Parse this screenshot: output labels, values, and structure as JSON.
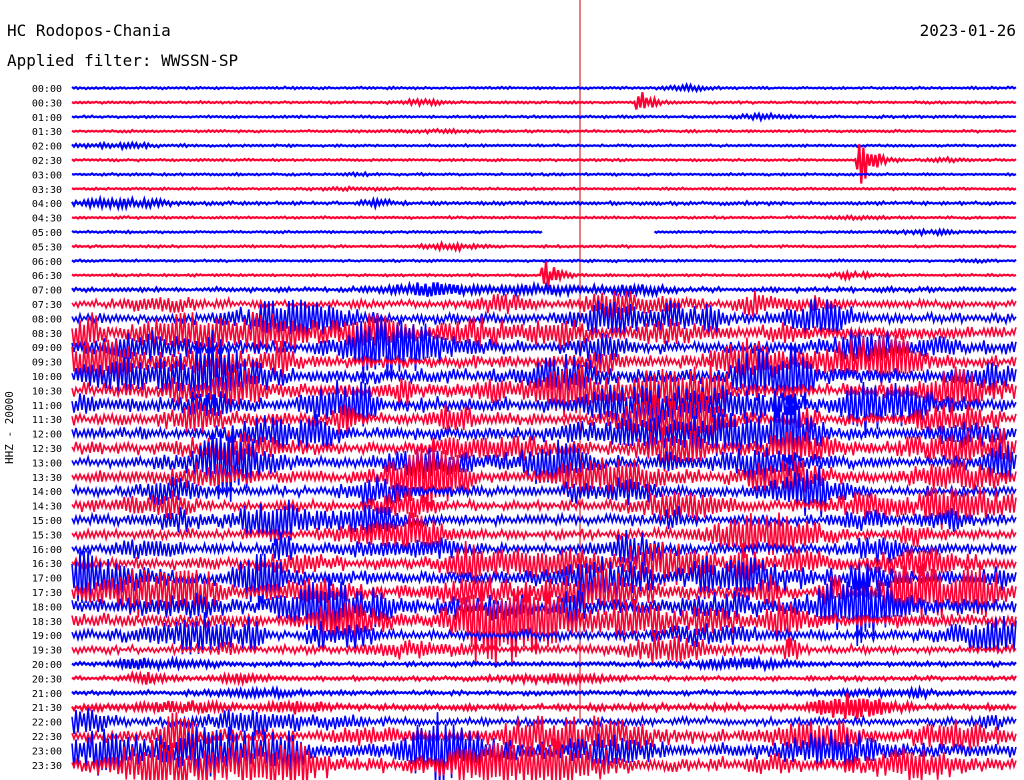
{
  "header": {
    "station": "HC Rodopos-Chania",
    "filter": "Applied filter: WWSSN-SP",
    "date": "2023-01-26",
    "channel": "HHZ - 20000"
  },
  "colors": {
    "trace_a": "#0000ff",
    "trace_b": "#ff0033",
    "marker": "#cc0000"
  },
  "chart_data": {
    "type": "line",
    "title": "HC Rodopos-Chania",
    "subtitle": "Applied filter: WWSSN-SP",
    "ylabel": "HHZ - 20000",
    "row_labels": [
      "00:00",
      "00:30",
      "01:00",
      "01:30",
      "02:00",
      "02:30",
      "03:00",
      "03:30",
      "04:00",
      "04:30",
      "05:00",
      "05:30",
      "06:00",
      "06:30",
      "07:00",
      "07:30",
      "08:00",
      "08:30",
      "09:00",
      "09:30",
      "10:00",
      "10:30",
      "11:00",
      "11:30",
      "12:00",
      "12:30",
      "13:00",
      "13:30",
      "14:00",
      "14:30",
      "15:00",
      "15:30",
      "16:00",
      "16:30",
      "17:00",
      "17:30",
      "18:00",
      "18:30",
      "19:00",
      "19:30",
      "20:00",
      "20:30",
      "21:00",
      "21:30",
      "22:00",
      "22:30",
      "23:00",
      "23:30"
    ],
    "row_minutes": 30,
    "series": [
      {
        "values": [
          1,
          1,
          1,
          1,
          1,
          1,
          1,
          1,
          1.5,
          1,
          1,
          1,
          1,
          1,
          2,
          4,
          5,
          6,
          6,
          6,
          7,
          7,
          7,
          6,
          6,
          6,
          6,
          6,
          5,
          5,
          5,
          5,
          5,
          6,
          7,
          7,
          7,
          7,
          5,
          4,
          2,
          2,
          2,
          3,
          4,
          6,
          7,
          7
        ]
      }
    ],
    "events": [
      {
        "row": "00:30",
        "minute": 18,
        "amplitude": 2.5
      },
      {
        "row": "02:30",
        "minute": 25,
        "amplitude": 6
      },
      {
        "row": "06:30",
        "minute": 15,
        "amplitude": 3
      }
    ],
    "gaps": [
      {
        "row": "05:00",
        "start_minute": 15,
        "end_minute": 18.5
      }
    ]
  }
}
